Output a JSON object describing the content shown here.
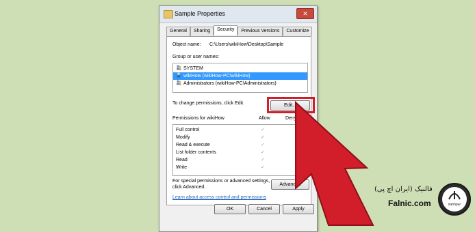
{
  "window": {
    "title": "Sample Properties",
    "close_glyph": "✕"
  },
  "tabs": [
    {
      "label": "General"
    },
    {
      "label": "Sharing"
    },
    {
      "label": "Security"
    },
    {
      "label": "Previous Versions"
    },
    {
      "label": "Customize"
    }
  ],
  "active_tab": "Security",
  "object_name": {
    "label": "Object name:",
    "value": "C:\\Users\\wikiHow\\Desktop\\Sample"
  },
  "groups": {
    "label": "Group or user names:",
    "items": [
      {
        "name": "SYSTEM",
        "selected": false
      },
      {
        "name": "wikiHow (wikiHow-PC\\wikiHow)",
        "selected": true
      },
      {
        "name": "Administrators (wikiHow-PC\\Administrators)",
        "selected": false
      }
    ]
  },
  "change_hint": "To change permissions, click Edit.",
  "edit_button": "Edit...",
  "permissions": {
    "label": "Permissions for wikiHow",
    "allow_header": "Allow",
    "deny_header": "Deny",
    "rows": [
      {
        "name": "Full control",
        "allow": "✓"
      },
      {
        "name": "Modify",
        "allow": "✓"
      },
      {
        "name": "Read & execute",
        "allow": "✓"
      },
      {
        "name": "List folder contents",
        "allow": "✓"
      },
      {
        "name": "Read",
        "allow": "✓"
      },
      {
        "name": "Write",
        "allow": "✓"
      }
    ]
  },
  "special_text_1": "For special permissions or advanced settings,",
  "special_text_2": "click Advanced.",
  "advanced_button": "Advanced",
  "learn_link": "Learn about access control and permissions",
  "footer": {
    "ok": "OK",
    "cancel": "Cancel",
    "apply": "Apply"
  },
  "brand": {
    "persian": "فالنیک (ایران اچ پی)",
    "site": "Falnic.com",
    "logo_text": "iranhpar"
  },
  "colors": {
    "background": "#cfdfb5",
    "arrow": "#d21d2a",
    "selection": "#3399ff"
  }
}
